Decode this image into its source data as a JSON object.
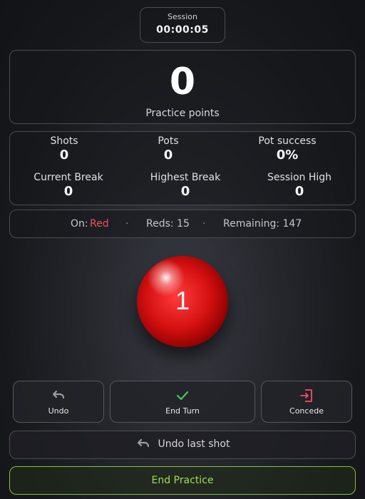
{
  "session": {
    "label": "Session",
    "time": "00:00:05"
  },
  "points": {
    "value": "0",
    "label": "Practice points"
  },
  "stats": {
    "shots": {
      "label": "Shots",
      "value": "0"
    },
    "pots": {
      "label": "Pots",
      "value": "0"
    },
    "pot_success": {
      "label": "Pot success",
      "value": "0%"
    },
    "current_break": {
      "label": "Current Break",
      "value": "0"
    },
    "highest_break": {
      "label": "Highest Break",
      "value": "0"
    },
    "session_high": {
      "label": "Session High",
      "value": "0"
    }
  },
  "info": {
    "on_label": "On:",
    "on_value": "Red",
    "separator": "·",
    "reds": "Reds: 15",
    "remaining": "Remaining: 147"
  },
  "ball": {
    "number": "1",
    "color": "#d41010"
  },
  "actions": {
    "undo": {
      "label": "Undo",
      "icon": "undo-icon"
    },
    "end_turn": {
      "label": "End Turn",
      "icon": "check-icon"
    },
    "concede": {
      "label": "Concede",
      "icon": "exit-icon"
    }
  },
  "undo_last_shot": {
    "label": "Undo last shot",
    "icon": "undo-icon"
  },
  "end_practice": {
    "label": "End Practice",
    "accent": "#86c23a"
  },
  "colors": {
    "red_text": "#f05252",
    "check_green": "#3ecf5a",
    "concede_red": "#f0506a"
  }
}
